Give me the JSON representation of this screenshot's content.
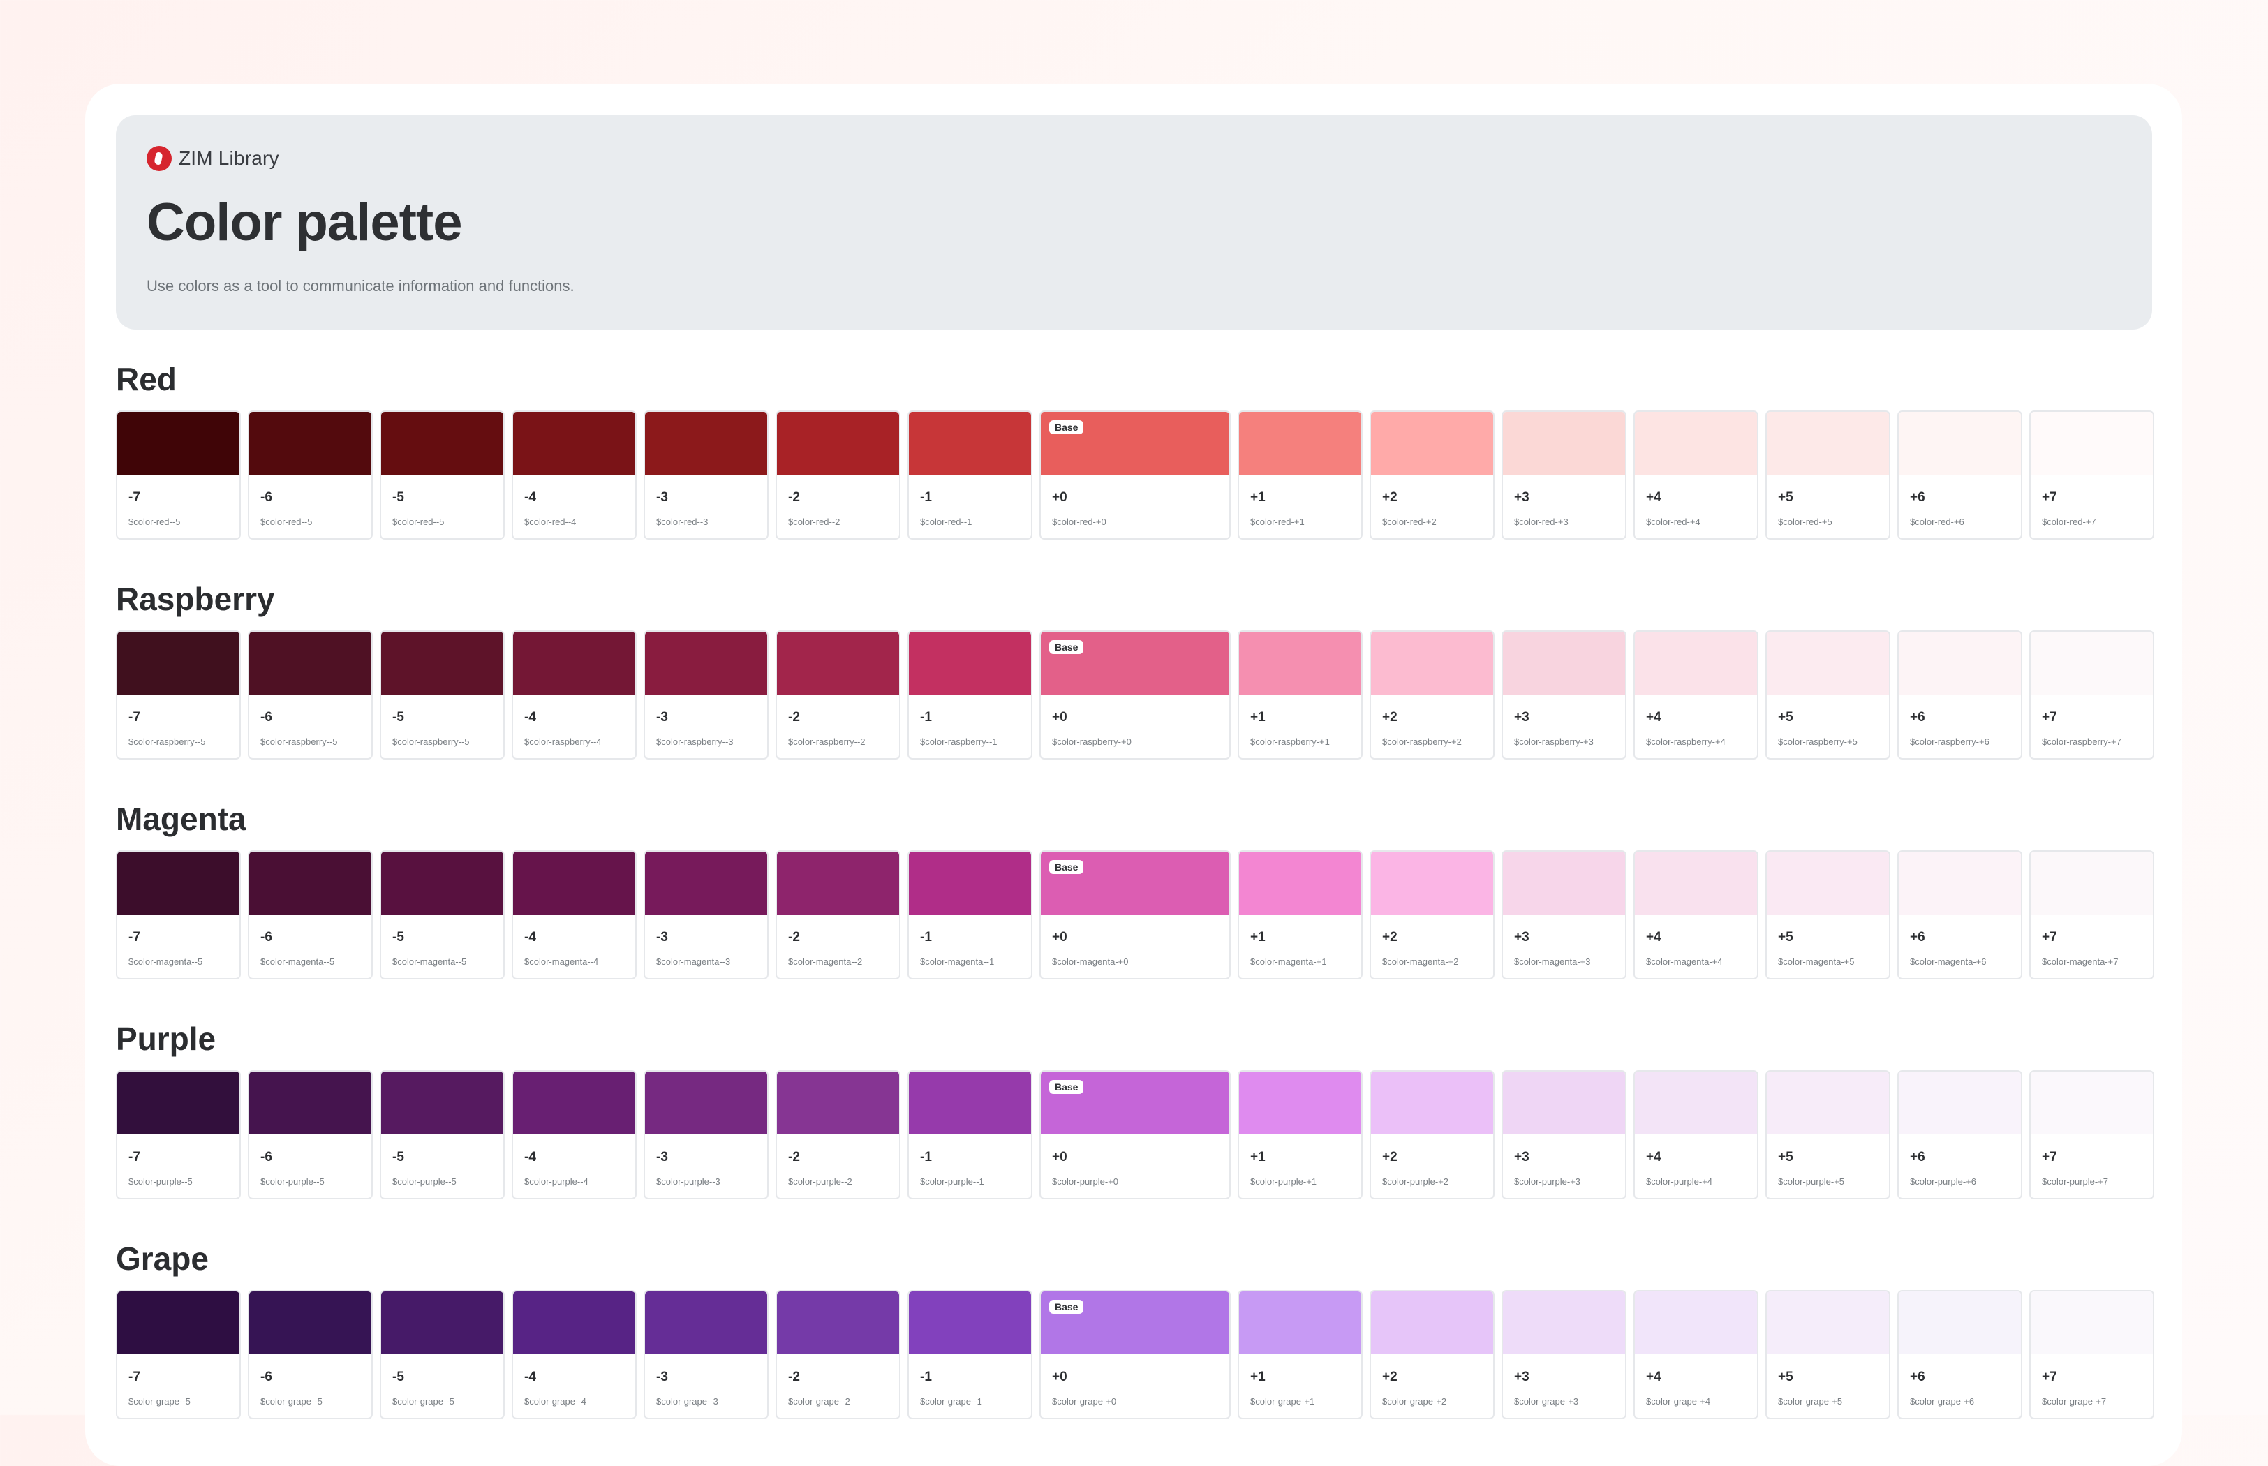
{
  "header": {
    "brand": "ZIM Library",
    "title": "Color palette",
    "subtitle": "Use colors as a tool to communicate information and functions."
  },
  "base_badge": "Base",
  "palettes": [
    {
      "name": "Red",
      "swatches": [
        {
          "step": "-7",
          "token": "$color-red--5",
          "color": "#400507"
        },
        {
          "step": "-6",
          "token": "$color-red--5",
          "color": "#530a0d"
        },
        {
          "step": "-5",
          "token": "$color-red--5",
          "color": "#650d10"
        },
        {
          "step": "-4",
          "token": "$color-red--4",
          "color": "#7a1317"
        },
        {
          "step": "-3",
          "token": "$color-red--3",
          "color": "#8c191b"
        },
        {
          "step": "-2",
          "token": "$color-red--2",
          "color": "#a82226"
        },
        {
          "step": "-1",
          "token": "$color-red--1",
          "color": "#c73638"
        },
        {
          "step": "+0",
          "token": "$color-red-+0",
          "color": "#e85e5c",
          "base": true
        },
        {
          "step": "+1",
          "token": "$color-red-+1",
          "color": "#f5807d"
        },
        {
          "step": "+2",
          "token": "$color-red-+2",
          "color": "#ffaaa9"
        },
        {
          "step": "+3",
          "token": "$color-red-+3",
          "color": "#fbd8d6"
        },
        {
          "step": "+4",
          "token": "$color-red-+4",
          "color": "#fde4e3"
        },
        {
          "step": "+5",
          "token": "$color-red-+5",
          "color": "#fde9e8"
        },
        {
          "step": "+6",
          "token": "$color-red-+6",
          "color": "#fef5f4"
        },
        {
          "step": "+7",
          "token": "$color-red-+7",
          "color": "#fffafa"
        }
      ]
    },
    {
      "name": "Raspberry",
      "swatches": [
        {
          "step": "-7",
          "token": "$color-raspberry--5",
          "color": "#40101e"
        },
        {
          "step": "-6",
          "token": "$color-raspberry--5",
          "color": "#4f1124"
        },
        {
          "step": "-5",
          "token": "$color-raspberry--5",
          "color": "#5e1329"
        },
        {
          "step": "-4",
          "token": "$color-raspberry--4",
          "color": "#741735"
        },
        {
          "step": "-3",
          "token": "$color-raspberry--3",
          "color": "#891c3f"
        },
        {
          "step": "-2",
          "token": "$color-raspberry--2",
          "color": "#a2254b"
        },
        {
          "step": "-1",
          "token": "$color-raspberry--1",
          "color": "#c33061"
        },
        {
          "step": "+0",
          "token": "$color-raspberry-+0",
          "color": "#e36089",
          "base": true
        },
        {
          "step": "+1",
          "token": "$color-raspberry-+1",
          "color": "#f58fb0"
        },
        {
          "step": "+2",
          "token": "$color-raspberry-+2",
          "color": "#fcbbd0"
        },
        {
          "step": "+3",
          "token": "$color-raspberry-+3",
          "color": "#f8d4df"
        },
        {
          "step": "+4",
          "token": "$color-raspberry-+4",
          "color": "#fbe2e9"
        },
        {
          "step": "+5",
          "token": "$color-raspberry-+5",
          "color": "#fcebf0"
        },
        {
          "step": "+6",
          "token": "$color-raspberry-+6",
          "color": "#fdf4f6"
        },
        {
          "step": "+7",
          "token": "$color-raspberry-+7",
          "color": "#fdf9fa"
        }
      ]
    },
    {
      "name": "Magenta",
      "swatches": [
        {
          "step": "-7",
          "token": "$color-magenta--5",
          "color": "#3c0d2b"
        },
        {
          "step": "-6",
          "token": "$color-magenta--5",
          "color": "#4a0f34"
        },
        {
          "step": "-5",
          "token": "$color-magenta--5",
          "color": "#58113f"
        },
        {
          "step": "-4",
          "token": "$color-magenta--4",
          "color": "#66144b"
        },
        {
          "step": "-3",
          "token": "$color-magenta--3",
          "color": "#771a5b"
        },
        {
          "step": "-2",
          "token": "$color-magenta--2",
          "color": "#8e246c"
        },
        {
          "step": "-1",
          "token": "$color-magenta--1",
          "color": "#b02d88"
        },
        {
          "step": "+0",
          "token": "$color-magenta-+0",
          "color": "#dc5db2",
          "base": true
        },
        {
          "step": "+1",
          "token": "$color-magenta-+1",
          "color": "#f386d2"
        },
        {
          "step": "+2",
          "token": "$color-magenta-+2",
          "color": "#fbb5e5"
        },
        {
          "step": "+3",
          "token": "$color-magenta-+3",
          "color": "#f7d6ea"
        },
        {
          "step": "+4",
          "token": "$color-magenta-+4",
          "color": "#f9e1ee"
        },
        {
          "step": "+5",
          "token": "$color-magenta-+5",
          "color": "#fae9f3"
        },
        {
          "step": "+6",
          "token": "$color-magenta-+6",
          "color": "#fcf3f8"
        },
        {
          "step": "+7",
          "token": "$color-magenta-+7",
          "color": "#fcf8fa"
        }
      ]
    },
    {
      "name": "Purple",
      "swatches": [
        {
          "step": "-7",
          "token": "$color-purple--5",
          "color": "#320f3c"
        },
        {
          "step": "-6",
          "token": "$color-purple--5",
          "color": "#45144e"
        },
        {
          "step": "-5",
          "token": "$color-purple--5",
          "color": "#561a60"
        },
        {
          "step": "-4",
          "token": "$color-purple--4",
          "color": "#681f72"
        },
        {
          "step": "-3",
          "token": "$color-purple--3",
          "color": "#762981"
        },
        {
          "step": "-2",
          "token": "$color-purple--2",
          "color": "#863593"
        },
        {
          "step": "-1",
          "token": "$color-purple--1",
          "color": "#963aab"
        },
        {
          "step": "+0",
          "token": "$color-purple-+0",
          "color": "#c565d8",
          "base": true
        },
        {
          "step": "+1",
          "token": "$color-purple-+1",
          "color": "#df8bef"
        },
        {
          "step": "+2",
          "token": "$color-purple-+2",
          "color": "#ebc0f8"
        },
        {
          "step": "+3",
          "token": "$color-purple-+3",
          "color": "#efd6f5"
        },
        {
          "step": "+4",
          "token": "$color-purple-+4",
          "color": "#f3e4f7"
        },
        {
          "step": "+5",
          "token": "$color-purple-+5",
          "color": "#f7ecf9"
        },
        {
          "step": "+6",
          "token": "$color-purple-+6",
          "color": "#f9f3fb"
        },
        {
          "step": "+7",
          "token": "$color-purple-+7",
          "color": "#fbf8fc"
        }
      ]
    },
    {
      "name": "Grape",
      "swatches": [
        {
          "step": "-7",
          "token": "$color-grape--5",
          "color": "#2e0e42"
        },
        {
          "step": "-6",
          "token": "$color-grape--5",
          "color": "#361454"
        },
        {
          "step": "-5",
          "token": "$color-grape--5",
          "color": "#461a68"
        },
        {
          "step": "-4",
          "token": "$color-grape--4",
          "color": "#572385"
        },
        {
          "step": "-3",
          "token": "$color-grape--3",
          "color": "#652d96"
        },
        {
          "step": "-2",
          "token": "$color-grape--2",
          "color": "#753aa8"
        },
        {
          "step": "-1",
          "token": "$color-grape--1",
          "color": "#8241bd"
        },
        {
          "step": "+0",
          "token": "$color-grape-+0",
          "color": "#b176e7",
          "base": true
        },
        {
          "step": "+1",
          "token": "$color-grape-+1",
          "color": "#c79af4"
        },
        {
          "step": "+2",
          "token": "$color-grape-+2",
          "color": "#e6c5f9"
        },
        {
          "step": "+3",
          "token": "$color-grape-+3",
          "color": "#eedcf9"
        },
        {
          "step": "+4",
          "token": "$color-grape-+4",
          "color": "#f1e5fa"
        },
        {
          "step": "+5",
          "token": "$color-grape-+5",
          "color": "#f5edfa"
        },
        {
          "step": "+6",
          "token": "$color-grape-+6",
          "color": "#f6f3fb"
        },
        {
          "step": "+7",
          "token": "$color-grape-+7",
          "color": "#faf8fc"
        }
      ]
    }
  ]
}
